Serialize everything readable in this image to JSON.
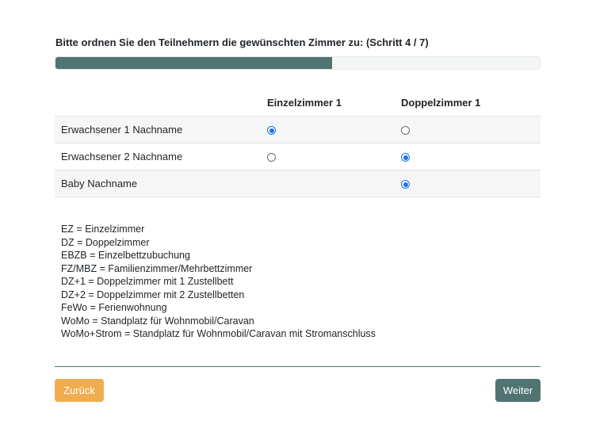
{
  "heading": "Bitte ordnen Sie den Teilnehmern die gewünschten Zimmer zu: (Schritt 4 / 7)",
  "progress": {
    "fraction": 0.571,
    "color": "#4f7472"
  },
  "table": {
    "columns": [
      "",
      "Einzelzimmer 1",
      "Doppelzimmer 1"
    ],
    "rows": [
      {
        "name": "Erwachsener 1 Nachname",
        "einzel": "checked",
        "doppel": "unchecked"
      },
      {
        "name": "Erwachsener 2 Nachname",
        "einzel": "unchecked",
        "doppel": "checked"
      },
      {
        "name": "Baby Nachname",
        "einzel": "none",
        "doppel": "checked"
      }
    ]
  },
  "legend": [
    "EZ = Einzelzimmer",
    "DZ = Doppelzimmer",
    "EBZB = Einzelbettzubuchung",
    "FZ/MBZ = Familienzimmer/Mehrbettzimmer",
    "DZ+1 = Doppelzimmer mit 1 Zustellbett",
    "DZ+2 = Doppelzimmer mit 2 Zustellbetten",
    "FeWo = Ferienwohnung",
    "WoMo = Standplatz für Wohnmobil/Caravan",
    "WoMo+Strom = Standplatz für Wohnmobil/Caravan mit Stromanschluss"
  ],
  "buttons": {
    "back_label": "Zurück",
    "next_label": "Weiter",
    "back_color": "#f0ad4e",
    "next_color": "#4f7472"
  }
}
